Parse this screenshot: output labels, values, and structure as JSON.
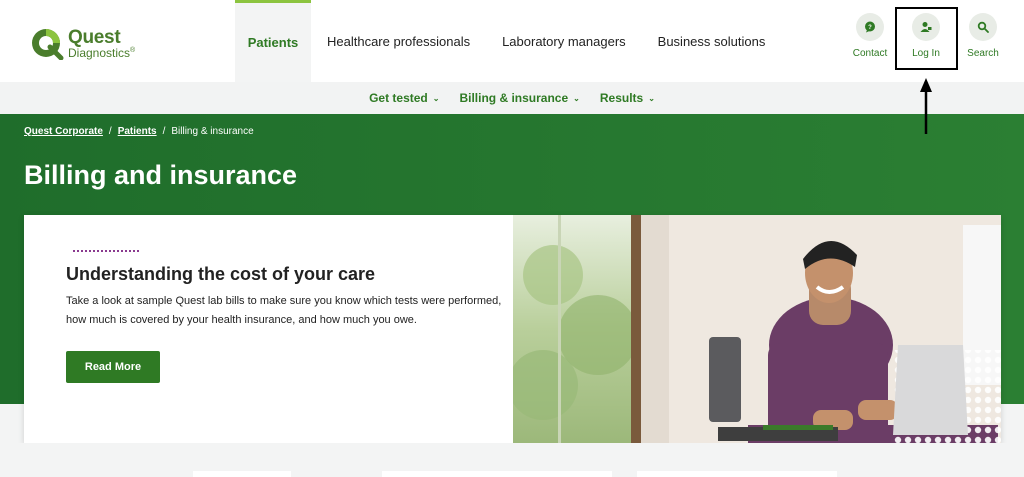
{
  "logo": {
    "name": "Quest",
    "sub": "Diagnostics",
    "mark": "®"
  },
  "nav": {
    "items": [
      {
        "label": "Patients"
      },
      {
        "label": "Healthcare professionals"
      },
      {
        "label": "Laboratory managers"
      },
      {
        "label": "Business solutions"
      }
    ]
  },
  "utility": {
    "contact": "Contact",
    "login": "Log In",
    "search": "Search"
  },
  "subnav": {
    "items": [
      {
        "label": "Get tested"
      },
      {
        "label": "Billing & insurance"
      },
      {
        "label": "Results"
      }
    ]
  },
  "breadcrumb": {
    "items": [
      "Quest Corporate",
      "Patients"
    ],
    "current": "Billing & insurance",
    "separator": "/"
  },
  "page": {
    "title": "Billing and insurance"
  },
  "card": {
    "title": "Understanding the cost of your care",
    "body": "Take a look at sample Quest lab bills to make sure you know which tests were performed, how much is covered by your health insurance, and how much you owe.",
    "button": "Read More"
  },
  "colors": {
    "brand_green": "#2f7a24",
    "hero_green": "#1f6d2b",
    "accent_lime": "#8cc43f",
    "dots_purple": "#8a3a8f"
  },
  "icons": {
    "contact": "chat-bubble-icon",
    "login": "user-icon",
    "search": "search-icon"
  }
}
